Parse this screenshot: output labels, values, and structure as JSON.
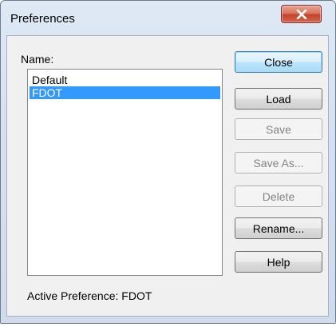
{
  "window": {
    "title": "Preferences",
    "close_icon": "close-x-icon"
  },
  "list": {
    "label": "Name:",
    "items": [
      {
        "label": "Default",
        "selected": false
      },
      {
        "label": "FDOT",
        "selected": true
      }
    ],
    "selection_color": "#3399ff"
  },
  "buttons": {
    "close": "Close",
    "load": "Load",
    "save": "Save",
    "save_as": "Save As...",
    "delete": "Delete",
    "rename": "Rename...",
    "help": "Help"
  },
  "status": {
    "text": "Active Preference: FDOT"
  }
}
